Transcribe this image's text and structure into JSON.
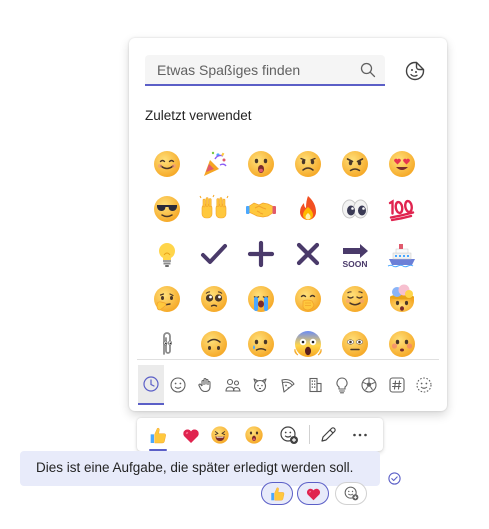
{
  "picker": {
    "search": {
      "value": "",
      "placeholder": "Etwas Spaßiges finden",
      "icon": "search-icon"
    },
    "sticker_button": {
      "icon": "sticker-icon"
    },
    "section_title": "Zuletzt verwendet",
    "recent_emojis": [
      "smiling-face",
      "party-popper",
      "surprised-face",
      "frowning-face",
      "angry-face",
      "heart-eyes-face",
      "sunglasses-face",
      "raising-hands",
      "handshake",
      "fire",
      "eyes",
      "hundred-points",
      "light-bulb",
      "check-mark",
      "plus",
      "cross-mark",
      "soon-arrow",
      "ship",
      "thinking-face",
      "pleading-face",
      "crying-face",
      "hand-over-mouth-face",
      "relieved-face",
      "exploding-head",
      "paperclip",
      "upside-down-face",
      "tear-face",
      "screaming-face",
      "neutral-face",
      "flushed-face"
    ],
    "category_tabs": [
      {
        "name": "recent",
        "icon": "clock-icon",
        "active": true
      },
      {
        "name": "smileys",
        "icon": "smiley-icon",
        "active": false
      },
      {
        "name": "hands",
        "icon": "hand-icon",
        "active": false
      },
      {
        "name": "people",
        "icon": "people-icon",
        "active": false
      },
      {
        "name": "animals",
        "icon": "animal-icon",
        "active": false
      },
      {
        "name": "food",
        "icon": "pizza-icon",
        "active": false
      },
      {
        "name": "places",
        "icon": "building-icon",
        "active": false
      },
      {
        "name": "objects",
        "icon": "bulb-icon",
        "active": false
      },
      {
        "name": "activities",
        "icon": "ball-icon",
        "active": false
      },
      {
        "name": "symbols",
        "icon": "hash-icon",
        "active": false
      },
      {
        "name": "custom",
        "icon": "dotted-smiley-icon",
        "active": false
      }
    ]
  },
  "reaction_bar": {
    "items": [
      "thumbs-up",
      "heart",
      "laughing-face",
      "surprised-face",
      "add-reaction-icon",
      "edit-icon",
      "more-icon"
    ]
  },
  "message": {
    "text": "Dies ist eine Aufgabe, die später erledigt werden soll.",
    "status_icon": "read-check-icon",
    "reactions": [
      {
        "emoji": "thumbs-up",
        "mine": true
      },
      {
        "emoji": "heart",
        "mine": true
      }
    ]
  },
  "colors": {
    "accent": "#5b5fc7",
    "bubble": "#e8ebfa",
    "emoji_yellow": "#ffc83d"
  }
}
